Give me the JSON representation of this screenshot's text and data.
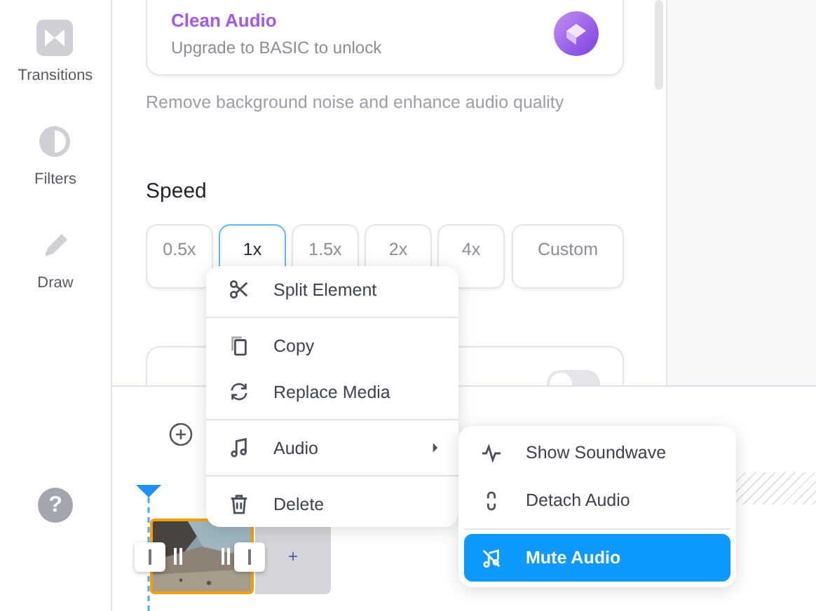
{
  "sidebar": {
    "items": [
      {
        "label": "Transitions",
        "kind": "transitions"
      },
      {
        "label": "Filters",
        "kind": "filters"
      },
      {
        "label": "Draw",
        "kind": "draw"
      }
    ],
    "help": "?"
  },
  "upgrade_card": {
    "title": "Clean Audio",
    "subtitle": "Upgrade to BASIC to unlock"
  },
  "description": "Remove background noise and enhance audio quality",
  "speed": {
    "heading": "Speed",
    "options": [
      {
        "label": "0.5x",
        "selected": false
      },
      {
        "label": "1x",
        "selected": true
      },
      {
        "label": "1.5x",
        "selected": false
      },
      {
        "label": "2x",
        "selected": false
      },
      {
        "label": "4x",
        "selected": false
      },
      {
        "label": "Custom",
        "selected": false
      }
    ]
  },
  "toggle_card": {
    "on": false
  },
  "context_menu": {
    "groups": [
      [
        {
          "label": "Split Element",
          "kind": "split",
          "submenu": false
        }
      ],
      [
        {
          "label": "Copy",
          "kind": "copy",
          "submenu": false
        },
        {
          "label": "Replace Media",
          "kind": "replace",
          "submenu": false
        }
      ],
      [
        {
          "label": "Audio",
          "kind": "audio",
          "submenu": true
        }
      ],
      [
        {
          "label": "Delete",
          "kind": "delete",
          "submenu": false
        }
      ]
    ]
  },
  "audio_submenu": {
    "groups": [
      [
        {
          "label": "Show Soundwave",
          "kind": "wave",
          "selected": false
        },
        {
          "label": "Detach Audio",
          "kind": "detach",
          "selected": false
        }
      ],
      [
        {
          "label": "Mute Audio",
          "kind": "mute",
          "selected": true
        }
      ]
    ]
  },
  "timeline": {
    "add_slot": "+",
    "clip": {
      "kind": "picture",
      "selected": true
    }
  }
}
